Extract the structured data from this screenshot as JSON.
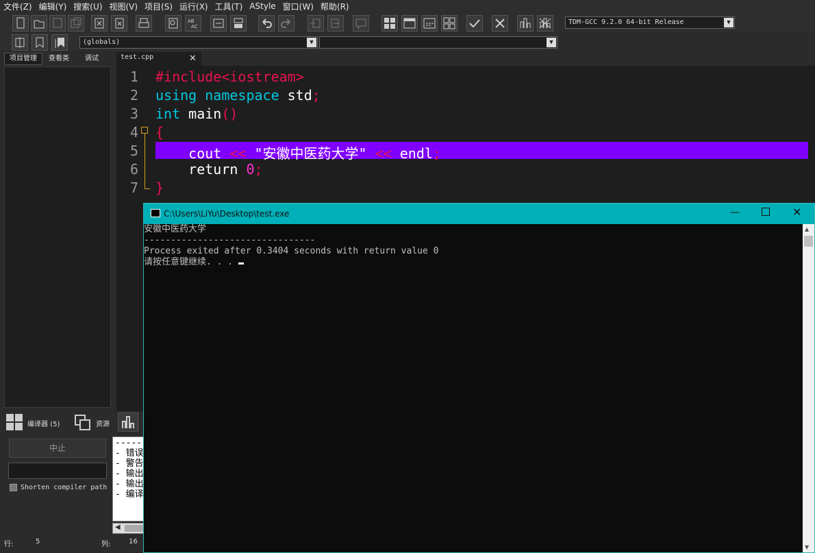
{
  "menu": [
    "文件(Z)",
    "编辑(Y)",
    "搜索(U)",
    "视图(V)",
    "项目(S)",
    "运行(X)",
    "工具(T)",
    "AStyle",
    "窗口(W)",
    "帮助(R)"
  ],
  "compiler_select": "TDM-GCC 9.2.0 64-bit Release",
  "scope_select": "(globals)",
  "left_tabs": [
    "项目管理",
    "查看类",
    "调试"
  ],
  "editor_tab": "test.cpp",
  "code_lines": [
    {
      "n": "1",
      "tokens": [
        {
          "t": "#include<iostream>",
          "c": "pp"
        }
      ]
    },
    {
      "n": "2",
      "tokens": [
        {
          "t": "using ",
          "c": "kw"
        },
        {
          "t": "namespace ",
          "c": "kw"
        },
        {
          "t": "std",
          "c": "id"
        },
        {
          "t": ";",
          "c": "op"
        }
      ]
    },
    {
      "n": "3",
      "tokens": [
        {
          "t": "int ",
          "c": "kw"
        },
        {
          "t": "main",
          "c": "id"
        },
        {
          "t": "()",
          "c": "op"
        }
      ]
    },
    {
      "n": "4",
      "tokens": [
        {
          "t": "{",
          "c": "op"
        }
      ]
    },
    {
      "n": "5",
      "tokens": [
        {
          "t": "    cout ",
          "c": "id"
        },
        {
          "t": "<< ",
          "c": "op"
        },
        {
          "t": "\"安徽中医药大学\" ",
          "c": "str"
        },
        {
          "t": "<< ",
          "c": "op"
        },
        {
          "t": "endl",
          "c": "id"
        },
        {
          "t": ";",
          "c": "op"
        }
      ]
    },
    {
      "n": "6",
      "tokens": [
        {
          "t": "    return ",
          "c": "id"
        },
        {
          "t": "0",
          "c": "num"
        },
        {
          "t": ";",
          "c": "op"
        }
      ]
    },
    {
      "n": "7",
      "tokens": [
        {
          "t": "}",
          "c": "op"
        }
      ]
    }
  ],
  "bottom_tabs": {
    "compiler": "编译器 (5)",
    "resources": "资源"
  },
  "abort_button": "中止",
  "shorten_label": "Shorten compiler path",
  "log_lines": [
    "-----",
    "- 错误",
    "- 警告",
    "- 输出",
    "- 输出",
    "- 编译"
  ],
  "status": {
    "row_label": "行:",
    "row_value": "5",
    "col_label": "列:",
    "col_value": "16"
  },
  "console": {
    "title": "C:\\Users\\LiYu\\Desktop\\test.exe",
    "lines": [
      "安徽中医药大学",
      "",
      "--------------------------------",
      "Process exited after 0.3404 seconds with return value 0",
      "请按任意键继续. . . "
    ]
  },
  "colors": {
    "highlight": "#8000ff",
    "console_titlebar": "#00b0b8"
  }
}
